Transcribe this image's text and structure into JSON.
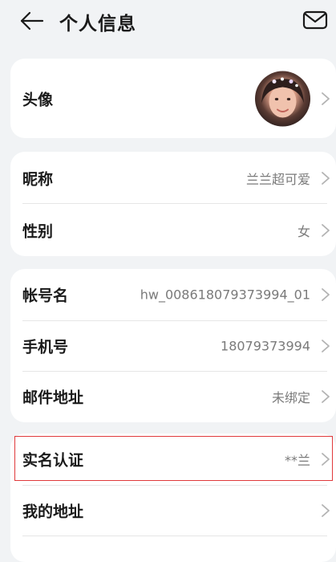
{
  "header": {
    "title": "个人信息",
    "back_icon": "back-arrow-icon",
    "mail_icon": "mail-icon"
  },
  "avatar_card": {
    "label": "头像"
  },
  "profile_card": {
    "nickname_label": "昵称",
    "nickname_value": "兰兰超可爱",
    "gender_label": "性别",
    "gender_value": "女"
  },
  "account_card": {
    "account_label": "帐号名",
    "account_value": "hw_008618079373994_01",
    "phone_label": "手机号",
    "phone_value": "18079373994",
    "email_label": "邮件地址",
    "email_value": "未绑定"
  },
  "identity_card": {
    "realname_label": "实名认证",
    "realname_value": "**兰",
    "address_label": "我的地址",
    "address_value": ""
  },
  "colors": {
    "background": "#f1f3f5",
    "card": "#ffffff",
    "highlight": "#e0393b",
    "secondary_text": "#7a7a7a"
  }
}
